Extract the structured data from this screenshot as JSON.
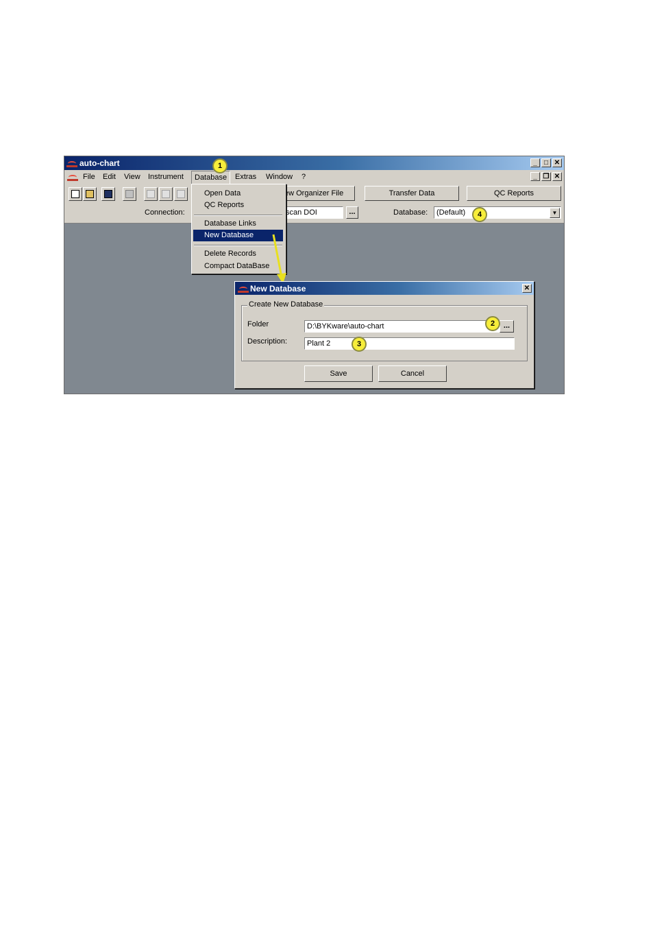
{
  "app": {
    "title": "auto-chart",
    "menus": [
      "File",
      "Edit",
      "View",
      "Instrument",
      "Database",
      "Extras",
      "Window",
      "?"
    ]
  },
  "toolbar": {
    "organizer_button": "ew Organizer File",
    "transfer_button": "Transfer Data",
    "qc_button": "QC Reports",
    "connection_label": "Connection:",
    "connection_value": "scan DOI",
    "browse_label": "...",
    "database_label": "Database:",
    "database_value": "(Default)"
  },
  "database_menu": {
    "items": [
      "Open Data",
      "QC Reports",
      "Database Links",
      "New Database",
      "Delete Records",
      "Compact DataBase"
    ],
    "selected": "New Database"
  },
  "dialog": {
    "title": "New Database",
    "group_label": "Create New Database",
    "folder_label": "Folder",
    "folder_value": "D:\\BYKware\\auto-chart",
    "browse_label": "...",
    "description_label": "Description:",
    "description_value": "Plant 2",
    "save_label": "Save",
    "cancel_label": "Cancel",
    "close_label": "✕"
  },
  "callouts": [
    "1",
    "2",
    "3",
    "4"
  ],
  "colors": {
    "title_bar": "#0a246a",
    "callout": "#f7ee3a",
    "selection": "#0a246a",
    "workspace": "#808890"
  }
}
